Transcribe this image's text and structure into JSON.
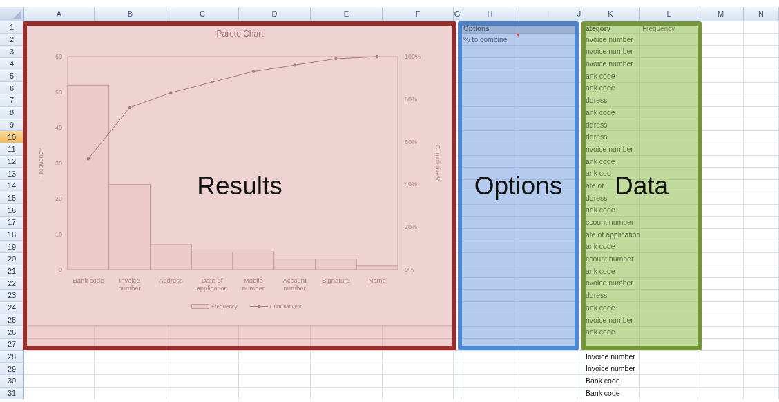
{
  "sheet": {
    "columns": [
      {
        "label": "A"
      },
      {
        "label": "B"
      },
      {
        "label": "C"
      },
      {
        "label": "D"
      },
      {
        "label": "E"
      },
      {
        "label": "F"
      },
      {
        "label": "G"
      },
      {
        "label": "H"
      },
      {
        "label": "I"
      },
      {
        "label": "J"
      },
      {
        "label": "K"
      },
      {
        "label": "L"
      },
      {
        "label": "M"
      },
      {
        "label": "N"
      }
    ],
    "rows": [
      {
        "number": "1",
        "selected": false,
        "kind": "header",
        "h": {
          "text": "Options",
          "comment": false
        },
        "k": "ategory",
        "l": "Frequency"
      },
      {
        "number": "2",
        "selected": false,
        "kind": "data",
        "h": {
          "text": "% to combine",
          "comment": true
        },
        "k": "nvoice number"
      },
      {
        "number": "3",
        "selected": false,
        "kind": "data",
        "k": "nvoice number"
      },
      {
        "number": "4",
        "selected": false,
        "kind": "data",
        "k": "nvoice number"
      },
      {
        "number": "5",
        "selected": false,
        "kind": "data",
        "k": "ank code"
      },
      {
        "number": "6",
        "selected": false,
        "kind": "data",
        "k": "ank code"
      },
      {
        "number": "7",
        "selected": false,
        "kind": "data",
        "k": "ddress"
      },
      {
        "number": "8",
        "selected": false,
        "kind": "data",
        "k": "ank code"
      },
      {
        "number": "9",
        "selected": false,
        "kind": "data",
        "k": "ddress"
      },
      {
        "number": "10",
        "selected": true,
        "kind": "data",
        "k": "ddress"
      },
      {
        "number": "11",
        "selected": false,
        "kind": "data",
        "k": "nvoice number"
      },
      {
        "number": "12",
        "selected": false,
        "kind": "data",
        "k": "ank code"
      },
      {
        "number": "13",
        "selected": false,
        "kind": "data",
        "k": "ank cod"
      },
      {
        "number": "14",
        "selected": false,
        "kind": "data",
        "k": "ate of"
      },
      {
        "number": "15",
        "selected": false,
        "kind": "data",
        "k": "ddress"
      },
      {
        "number": "16",
        "selected": false,
        "kind": "data",
        "k": "ank code"
      },
      {
        "number": "17",
        "selected": false,
        "kind": "data",
        "k": "ccount number"
      },
      {
        "number": "18",
        "selected": false,
        "kind": "data",
        "k": "ate of application"
      },
      {
        "number": "19",
        "selected": false,
        "kind": "data",
        "k": "ank code"
      },
      {
        "number": "20",
        "selected": false,
        "kind": "data",
        "k": "ccount number"
      },
      {
        "number": "21",
        "selected": false,
        "kind": "data",
        "k": "ank code"
      },
      {
        "number": "22",
        "selected": false,
        "kind": "data",
        "k": "nvoice number"
      },
      {
        "number": "23",
        "selected": false,
        "kind": "data",
        "k": "ddress"
      },
      {
        "number": "24",
        "selected": false,
        "kind": "data",
        "k": "ank code"
      },
      {
        "number": "25",
        "selected": false,
        "kind": "data",
        "k": "nvoice number"
      },
      {
        "number": "26",
        "selected": false,
        "kind": "data",
        "k": "ank code"
      },
      {
        "number": "27",
        "selected": false,
        "kind": "data"
      },
      {
        "number": "28",
        "selected": false,
        "kind": "data",
        "k": "Invoice number"
      },
      {
        "number": "29",
        "selected": false,
        "kind": "data",
        "k": "Invoice number"
      },
      {
        "number": "30",
        "selected": false,
        "kind": "data",
        "k": "Bank code"
      },
      {
        "number": "31",
        "selected": false,
        "kind": "data",
        "k": "Bank code"
      }
    ]
  },
  "regions": [
    {
      "kind": "results",
      "label": "Results"
    },
    {
      "kind": "options",
      "label": "Options"
    },
    {
      "kind": "data",
      "label": "Data"
    }
  ],
  "chart": {
    "chart_data": {
      "type": "bar",
      "title": "Pareto Chart",
      "ylabel": "Frequency",
      "y2label": "Cumulative%",
      "categories": [
        "Bank code",
        "Invoice number",
        "Address",
        "Date of application",
        "Mobile number",
        "Account number",
        "Signature",
        "Name"
      ],
      "series": [
        {
          "name": "Frequency",
          "type": "bar",
          "color": "#ebcaca",
          "values": [
            52,
            24,
            7,
            5,
            5,
            3,
            3,
            1
          ]
        },
        {
          "name": "Cumulative%",
          "type": "line",
          "axis": "y2",
          "color": "#a77878",
          "values": [
            52,
            76,
            83,
            88,
            93,
            96,
            99,
            100
          ]
        }
      ],
      "legend": "bottom",
      "ylim": [
        0,
        60
      ],
      "yticks": [
        0,
        10,
        20,
        30,
        40,
        50,
        60
      ],
      "y2lim": [
        0,
        100
      ],
      "y2ticks": [
        {
          "value": 0,
          "label": "0%"
        },
        {
          "value": 20,
          "label": "20%"
        },
        {
          "value": 40,
          "label": "40%"
        },
        {
          "value": 60,
          "label": "60%"
        },
        {
          "value": 80,
          "label": "80%"
        },
        {
          "value": 100,
          "label": "100%"
        }
      ]
    }
  }
}
